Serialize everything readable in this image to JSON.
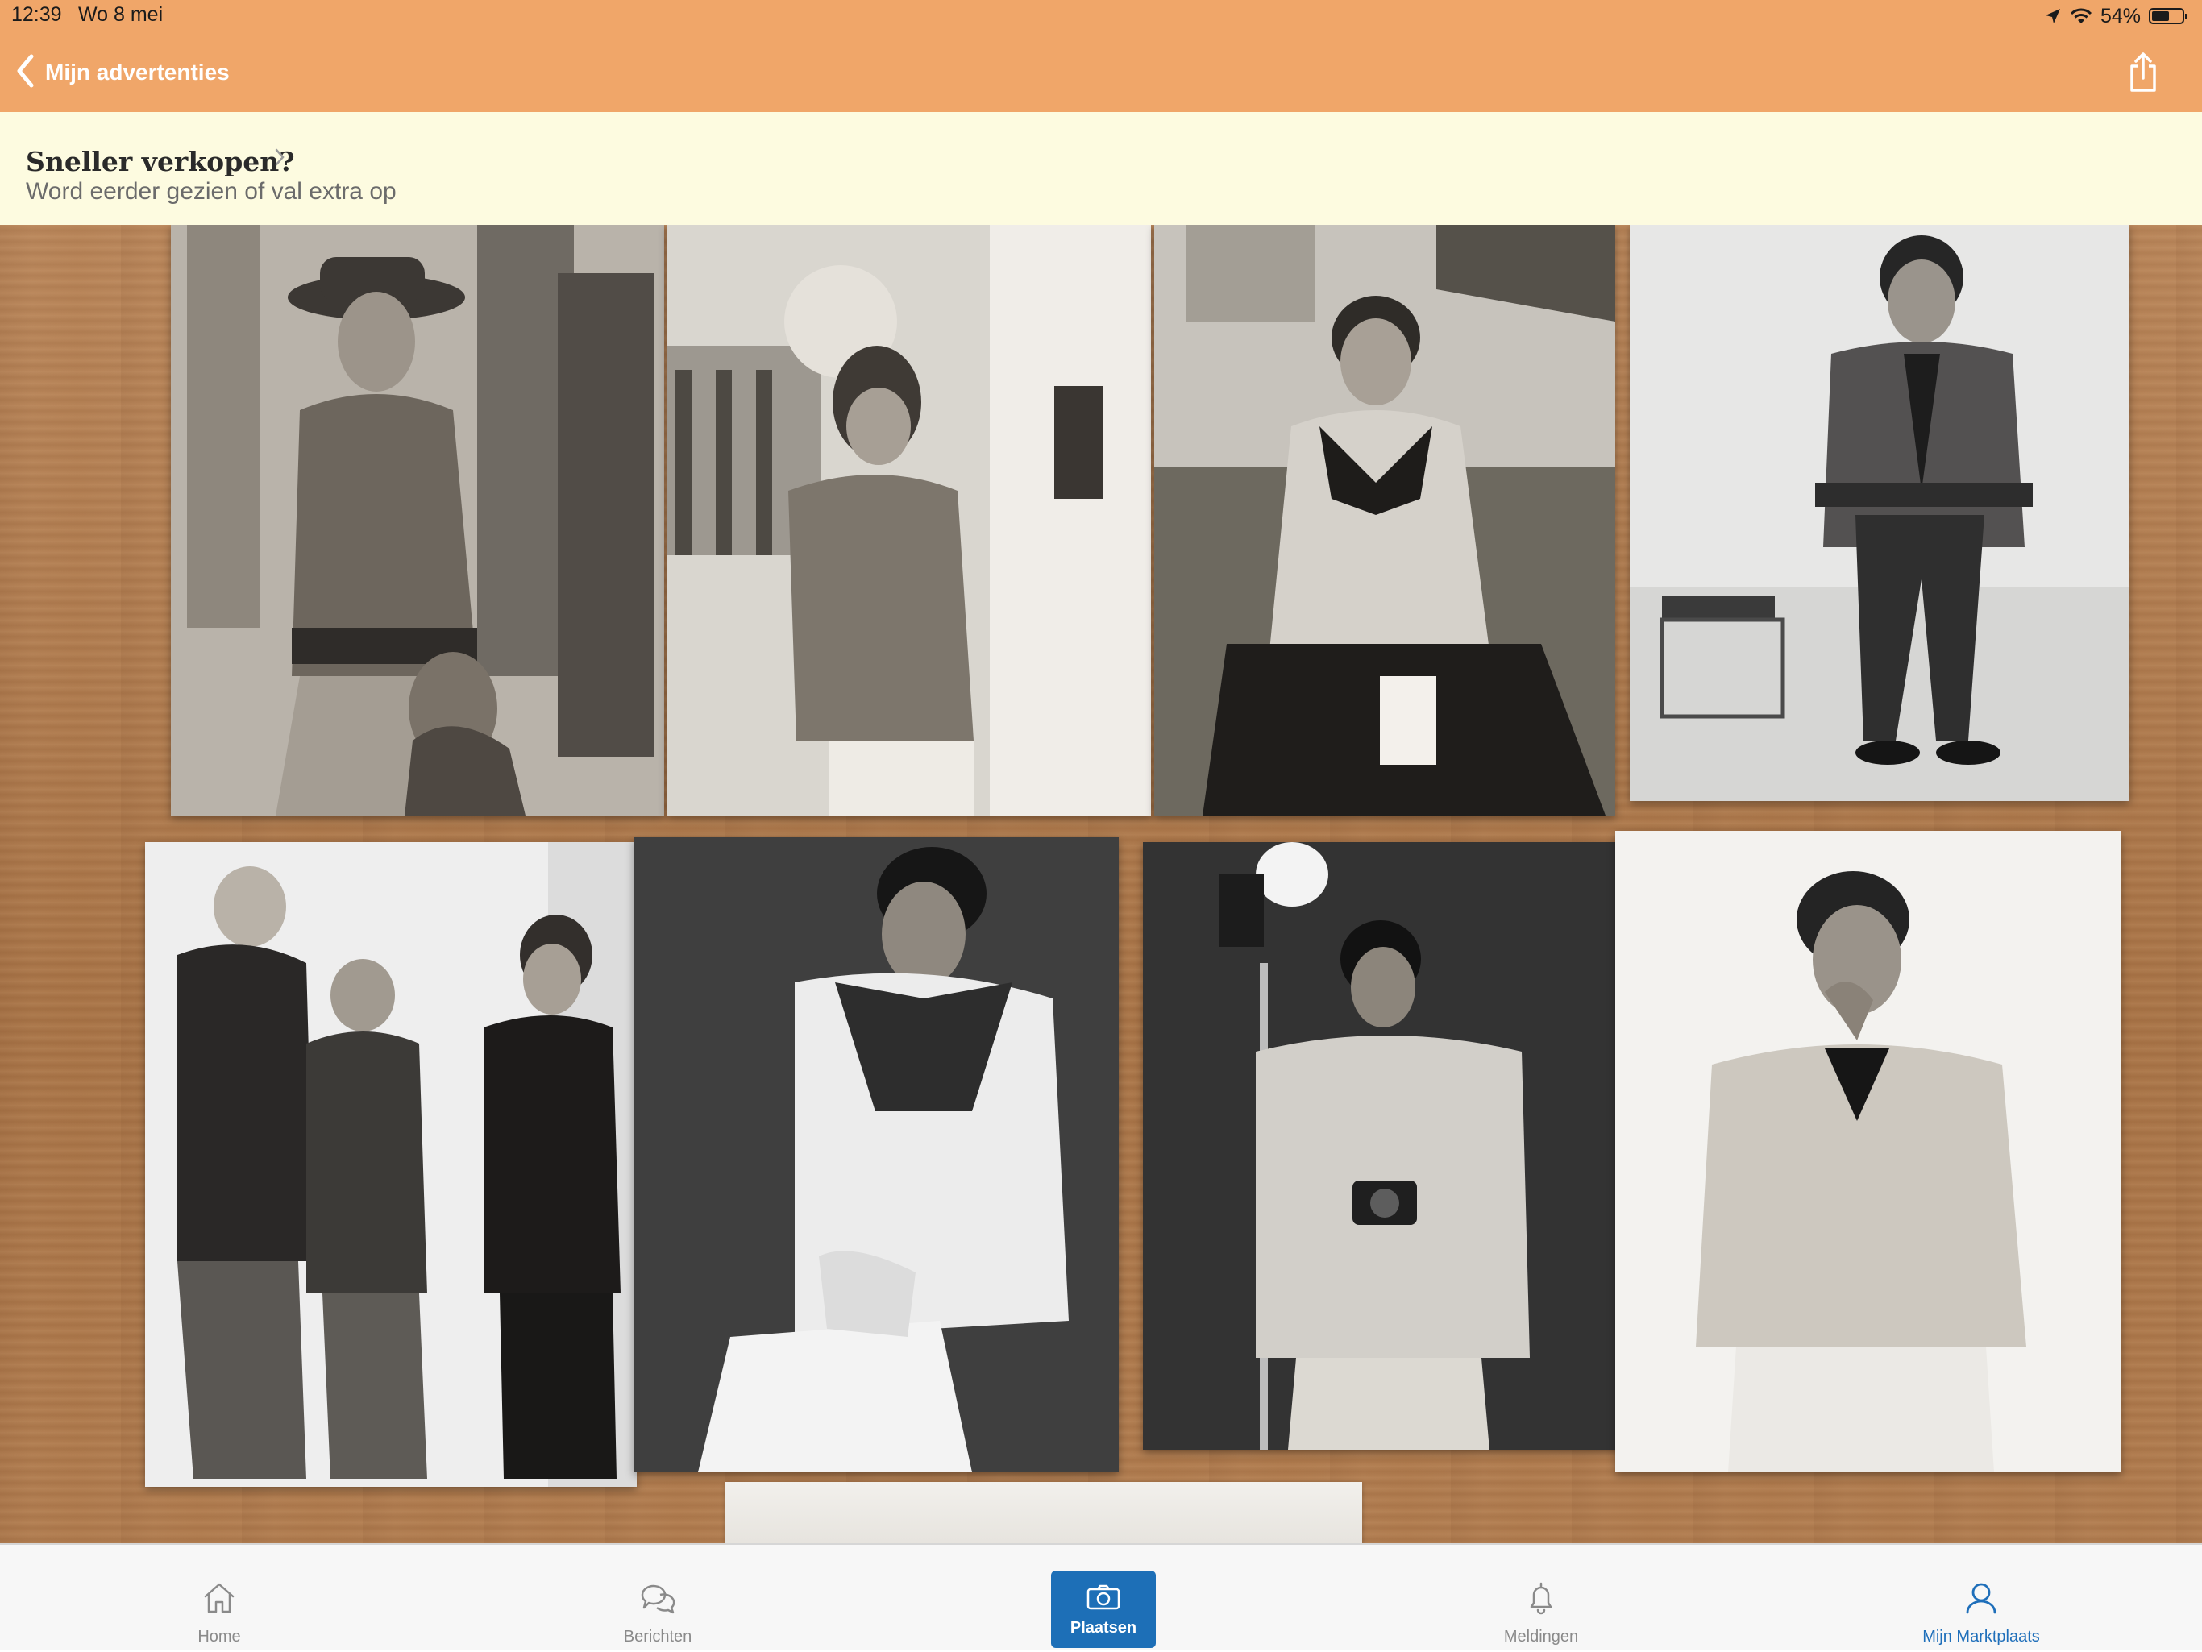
{
  "status_bar": {
    "time": "12:39",
    "date": "Wo 8 mei",
    "battery": "54%",
    "battery_level": 0.54,
    "icons": [
      "location-arrow-icon",
      "wifi-icon",
      "battery-icon"
    ]
  },
  "header": {
    "back_label": "Mijn advertenties",
    "back_icon": "chevron-left-icon",
    "share_icon": "share-icon",
    "background": "#f0a669"
  },
  "promo": {
    "title": "Sneller verkopen?",
    "subtitle": "Word eerder gezien of val extra op",
    "chevron_icon": "chevron-right-icon",
    "background": "#fdfbe0"
  },
  "listing_photo": {
    "description_items": 8,
    "prints": [
      {
        "name": "photo-print-1"
      },
      {
        "name": "photo-print-2"
      },
      {
        "name": "photo-print-3"
      },
      {
        "name": "photo-print-4"
      },
      {
        "name": "photo-print-5"
      },
      {
        "name": "photo-print-6"
      },
      {
        "name": "photo-print-7"
      },
      {
        "name": "photo-print-8"
      }
    ]
  },
  "tabbar": {
    "tabs": [
      {
        "label": "Home",
        "icon": "home-icon",
        "active": false
      },
      {
        "label": "Berichten",
        "icon": "chat-bubbles-icon",
        "active": false
      },
      {
        "label": "Plaatsen",
        "icon": "camera-icon",
        "active": false
      },
      {
        "label": "Meldingen",
        "icon": "bell-icon",
        "active": false
      },
      {
        "label": "Mijn Marktplaats",
        "icon": "user-icon",
        "active": true
      }
    ],
    "accent": "#1f6fba",
    "place_button_color": "#1d6fb7"
  }
}
